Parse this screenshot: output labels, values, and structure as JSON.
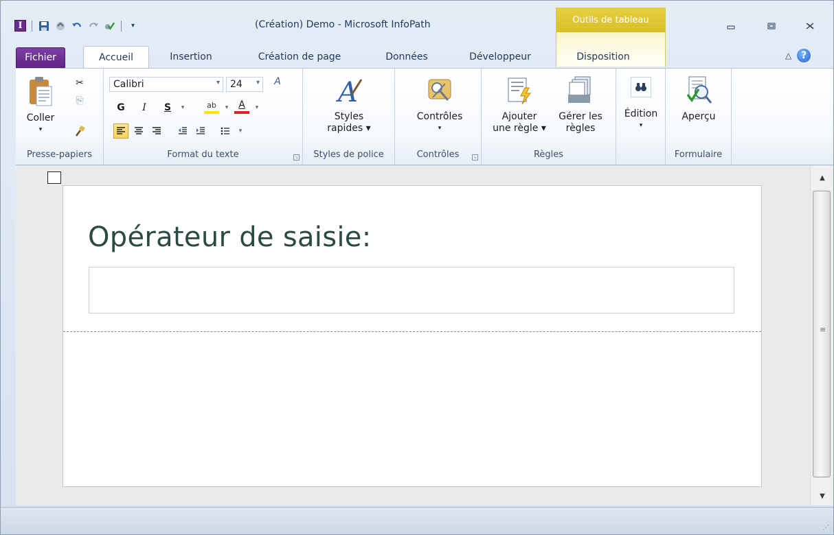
{
  "window": {
    "title": "(Création) Demo  -  Microsoft InfoPath",
    "app_icon_letter": "I",
    "context_tab_group": "Outils de tableau",
    "controls": {
      "minimize_icon": "minimize-icon",
      "restore_icon": "restore-icon",
      "close_icon": "close-icon"
    }
  },
  "quick_access": {
    "icons": [
      "infopath-logo-icon",
      "save-icon",
      "publish-icon",
      "undo-icon",
      "redo-icon",
      "check-icon",
      "customize-qat-icon"
    ]
  },
  "tabs": [
    {
      "label": "Fichier",
      "kind": "file"
    },
    {
      "label": "Accueil",
      "kind": "active"
    },
    {
      "label": "Insertion",
      "kind": "normal"
    },
    {
      "label": "Création de page",
      "kind": "normal"
    },
    {
      "label": "Données",
      "kind": "normal"
    },
    {
      "label": "Développeur",
      "kind": "normal"
    },
    {
      "label": "Disposition",
      "kind": "contextual"
    }
  ],
  "ribbon": {
    "clipboard": {
      "group_label": "Presse-papiers",
      "paste_label": "Coller"
    },
    "text_format": {
      "group_label": "Format du texte",
      "font_name": "Calibri",
      "font_size": "24",
      "bold": "G",
      "italic": "I",
      "underline": "S",
      "font_color_letter": "A",
      "highlight_letters": "ab"
    },
    "font_styles": {
      "group_label": "Styles de police",
      "button_label_1": "Styles",
      "button_label_2": "rapides"
    },
    "controls": {
      "group_label": "Contrôles",
      "button_label": "Contrôles"
    },
    "rules": {
      "group_label": "Règles",
      "add_rule_1": "Ajouter",
      "add_rule_2": "une règle",
      "manage_rules_1": "Gérer les",
      "manage_rules_2": "règles"
    },
    "editing": {
      "button_label": "Édition"
    },
    "form": {
      "group_label": "Formulaire",
      "preview_label": "Aperçu"
    }
  },
  "canvas": {
    "field_label": "Opérateur de saisie:",
    "field_value": ""
  },
  "colors": {
    "file_tab": "#6a2d8f",
    "context_group": "#e6cf3f",
    "label_text": "#2c4a44",
    "highlight_yellow": "#ffd35a"
  }
}
